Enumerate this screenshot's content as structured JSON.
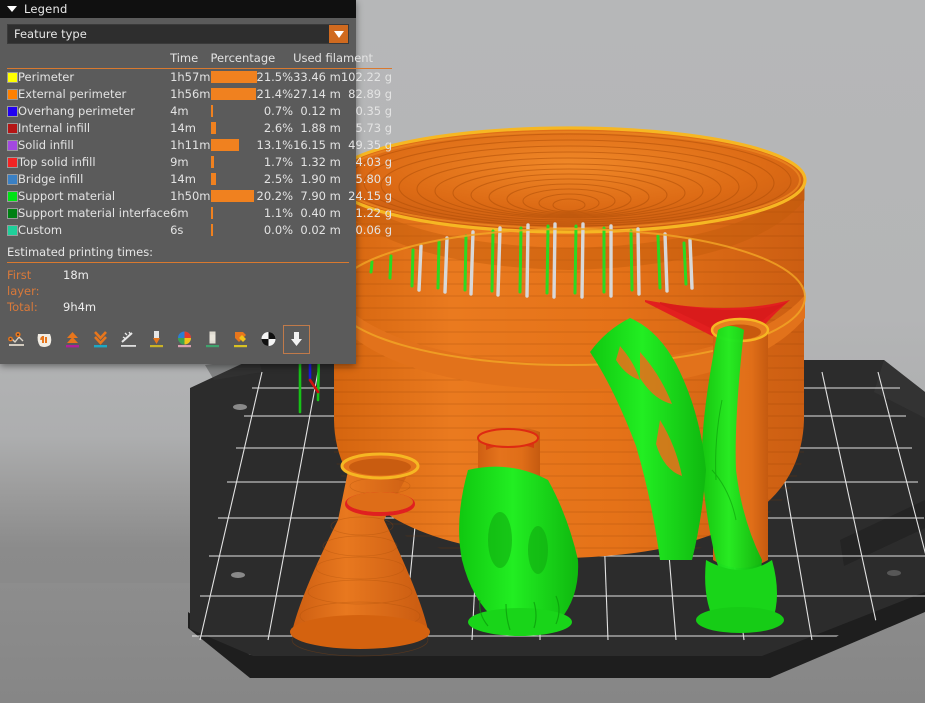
{
  "window": {
    "title": "Legend",
    "collapse_icon": "triangle-down-icon"
  },
  "viewport": {
    "background_top_color": "#b6b7b8",
    "background_bottom_color": "#868686",
    "build_plate_color": "#2b2b2b",
    "grid_line_color": "#ffffff",
    "model_color": "#e2701a",
    "support_color": "#1ee01e",
    "top_solid_infill_color": "#e02020",
    "perimeter_highlight_color": "#f5c518"
  },
  "legend": {
    "view_type": {
      "label": "Feature type",
      "dropdown_icon": "triangle-down-icon",
      "accent": "#d06a1f"
    },
    "columns": [
      "",
      "",
      "Time",
      "Percentage",
      "Used filament"
    ],
    "rows": [
      {
        "color": "#ffff00",
        "name": "Perimeter",
        "time": "1h57m",
        "percentage": "21.5%",
        "pct_value": 21.5,
        "length": "33.46 m",
        "mass": "102.22 g"
      },
      {
        "color": "#ff8000",
        "name": "External perimeter",
        "time": "1h56m",
        "percentage": "21.4%",
        "pct_value": 21.4,
        "length": "27.14 m",
        "mass": "82.89 g"
      },
      {
        "color": "#2000f0",
        "name": "Overhang perimeter",
        "time": "4m",
        "percentage": "0.7%",
        "pct_value": 0.7,
        "length": "0.12 m",
        "mass": "0.35 g"
      },
      {
        "color": "#b51515",
        "name": "Internal infill",
        "time": "14m",
        "percentage": "2.6%",
        "pct_value": 2.6,
        "length": "1.88 m",
        "mass": "5.73 g"
      },
      {
        "color": "#a349e0",
        "name": "Solid infill",
        "time": "1h11m",
        "percentage": "13.1%",
        "pct_value": 13.1,
        "length": "16.15 m",
        "mass": "49.35 g"
      },
      {
        "color": "#f32323",
        "name": "Top solid infill",
        "time": "9m",
        "percentage": "1.7%",
        "pct_value": 1.7,
        "length": "1.32 m",
        "mass": "4.03 g"
      },
      {
        "color": "#3a80c4",
        "name": "Bridge infill",
        "time": "14m",
        "percentage": "2.5%",
        "pct_value": 2.5,
        "length": "1.90 m",
        "mass": "5.80 g"
      },
      {
        "color": "#00e215",
        "name": "Support material",
        "time": "1h50m",
        "percentage": "20.2%",
        "pct_value": 20.2,
        "length": "7.90 m",
        "mass": "24.15 g"
      },
      {
        "color": "#008013",
        "name": "Support material interface",
        "time": "6m",
        "percentage": "1.1%",
        "pct_value": 1.1,
        "length": "0.40 m",
        "mass": "1.22 g"
      },
      {
        "color": "#1ecf9a",
        "name": "Custom",
        "time": "6s",
        "percentage": "0.0%",
        "pct_value": 0.0,
        "length": "0.02 m",
        "mass": "0.06 g"
      }
    ],
    "times": {
      "heading": "Estimated printing times:",
      "entries": [
        {
          "label": "First layer:",
          "value": "18m"
        },
        {
          "label": "Total:",
          "value": "9h4m"
        }
      ]
    },
    "toolbar": [
      {
        "icon": "travel-icon",
        "selected": false
      },
      {
        "icon": "retractions-icon",
        "selected": false
      },
      {
        "icon": "deretractions-icon",
        "selected": false
      },
      {
        "icon": "seams-icon",
        "selected": false
      },
      {
        "icon": "tool-changes-icon",
        "selected": false
      },
      {
        "icon": "color-changes-icon",
        "selected": false
      },
      {
        "icon": "pause-prints-icon",
        "selected": false
      },
      {
        "icon": "custom-gcodes-icon",
        "selected": false
      },
      {
        "icon": "shells-icon",
        "selected": false
      },
      {
        "icon": "tool-marker-icon",
        "selected": false
      },
      {
        "icon": "legend-toggle-icon",
        "selected": true
      }
    ]
  }
}
